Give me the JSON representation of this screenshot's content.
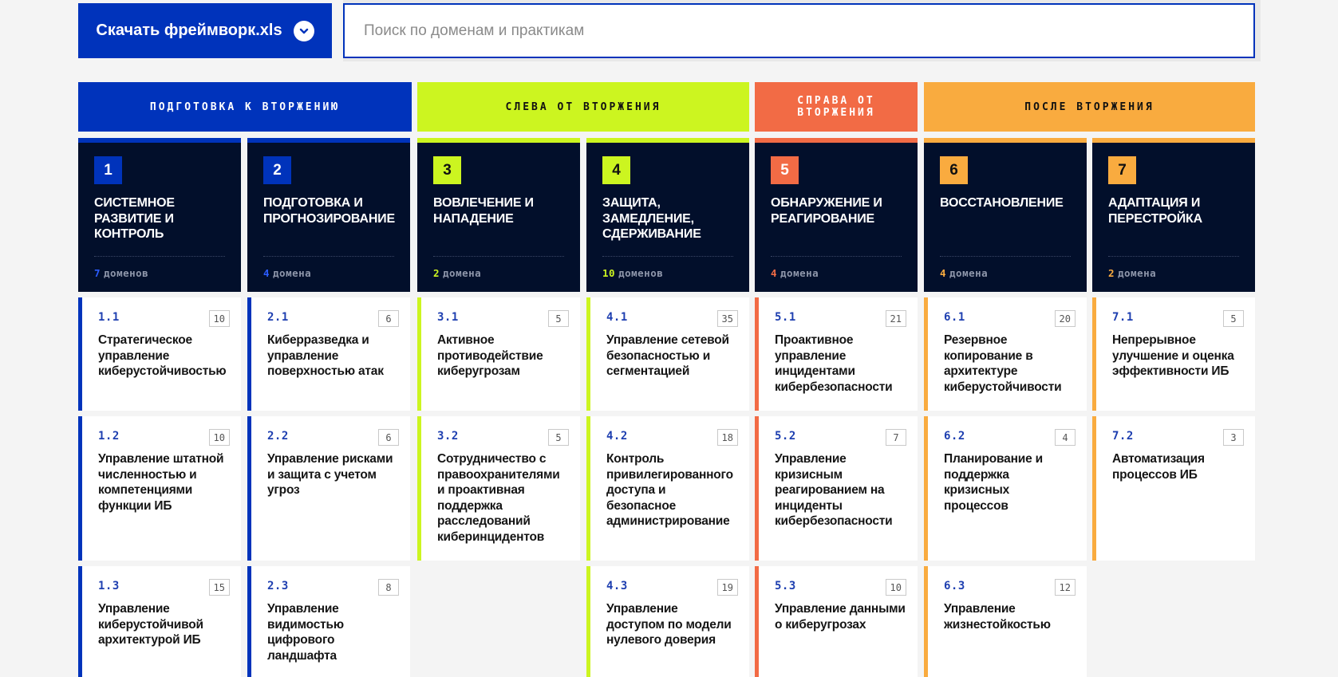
{
  "toolbar": {
    "download_label": "Скачать фреймворк.xls",
    "search_placeholder": "Поиск по доменам и практикам",
    "search_value": ""
  },
  "phases": [
    {
      "label": "ПОДГОТОВКА К ВТОРЖЕНИЮ",
      "color": "#0033bb",
      "text_color": "#ffffff"
    },
    {
      "label": "СЛЕВА ОТ ВТОРЖЕНИЯ",
      "color": "#ccf520",
      "text_color": "#111111"
    },
    {
      "label": "СПРАВА ОТ ВТОРЖЕНИЯ",
      "color": "#f26b45",
      "text_color": "#ffffff"
    },
    {
      "label": "ПОСЛЕ ВТОРЖЕНИЯ",
      "color": "#f9ab3f",
      "text_color": "#111111"
    }
  ],
  "columns": [
    {
      "num": "1",
      "title": "Системное развитие и контроль",
      "count": "7",
      "count_label": "доменов",
      "color": "#0033bb",
      "num_text": "#ffffff",
      "cards": [
        {
          "code": "1.1",
          "badge": "10",
          "title": "Стратегическое управление киберустойчивостью"
        },
        {
          "code": "1.2",
          "badge": "10",
          "title": "Управление штатной численностью и компетенциями функции ИБ"
        },
        {
          "code": "1.3",
          "badge": "15",
          "title": "Управление киберустойчивой архитектурой ИБ"
        }
      ]
    },
    {
      "num": "2",
      "title": "Подготовка и прогнозирование",
      "count": "4",
      "count_label": "домена",
      "color": "#0033bb",
      "num_text": "#ffffff",
      "cards": [
        {
          "code": "2.1",
          "badge": "6",
          "title": "Киберразведка и управление поверхностью атак"
        },
        {
          "code": "2.2",
          "badge": "6",
          "title": "Управление рисками и защита с учетом угроз"
        },
        {
          "code": "2.3",
          "badge": "8",
          "title": "Управление видимостью цифрового ландшафта"
        }
      ]
    },
    {
      "num": "3",
      "title": "Вовлечение и нападение",
      "count": "2",
      "count_label": "домена",
      "color": "#ccf520",
      "num_text": "#111111",
      "cards": [
        {
          "code": "3.1",
          "badge": "5",
          "title": "Активное противодействие киберугрозам"
        },
        {
          "code": "3.2",
          "badge": "5",
          "title": "Сотрудничество с правоохранителями и проактивная поддержка расследований киберинцидентов"
        }
      ]
    },
    {
      "num": "4",
      "title": "Защита, замедление, сдерживание",
      "count": "10",
      "count_label": "доменов",
      "color": "#ccf520",
      "num_text": "#111111",
      "cards": [
        {
          "code": "4.1",
          "badge": "35",
          "title": "Управление сетевой безопасностью и сегментацией"
        },
        {
          "code": "4.2",
          "badge": "18",
          "title": "Контроль привилегированного доступа и безопасное администрирование"
        },
        {
          "code": "4.3",
          "badge": "19",
          "title": "Управление доступом по модели нулевого доверия"
        }
      ]
    },
    {
      "num": "5",
      "title": "Обнаружение и реагирование",
      "count": "4",
      "count_label": "домена",
      "color": "#f26b45",
      "num_text": "#ffffff",
      "cards": [
        {
          "code": "5.1",
          "badge": "21",
          "title": "Проактивное управление инцидентами кибербезопасности"
        },
        {
          "code": "5.2",
          "badge": "7",
          "title": "Управление кризисным реагированием на инциденты кибербезопасности"
        },
        {
          "code": "5.3",
          "badge": "10",
          "title": "Управление данными о киберугрозах"
        }
      ]
    },
    {
      "num": "6",
      "title": "Восстановление",
      "count": "4",
      "count_label": "домена",
      "color": "#f9ab3f",
      "num_text": "#111111",
      "cards": [
        {
          "code": "6.1",
          "badge": "20",
          "title": "Резервное копирование в архитектуре киберустойчивости"
        },
        {
          "code": "6.2",
          "badge": "4",
          "title": "Планирование и поддержка кризисных процессов"
        },
        {
          "code": "6.3",
          "badge": "12",
          "title": "Управление жизнестойкостью"
        }
      ]
    },
    {
      "num": "7",
      "title": "Адаптация и перестройка",
      "count": "2",
      "count_label": "домена",
      "color": "#f9ab3f",
      "num_text": "#111111",
      "cards": [
        {
          "code": "7.1",
          "badge": "5",
          "title": "Непрерывное улучшение и оценка эффективности ИБ"
        },
        {
          "code": "7.2",
          "badge": "3",
          "title": "Автоматизация процессов ИБ"
        }
      ]
    }
  ]
}
